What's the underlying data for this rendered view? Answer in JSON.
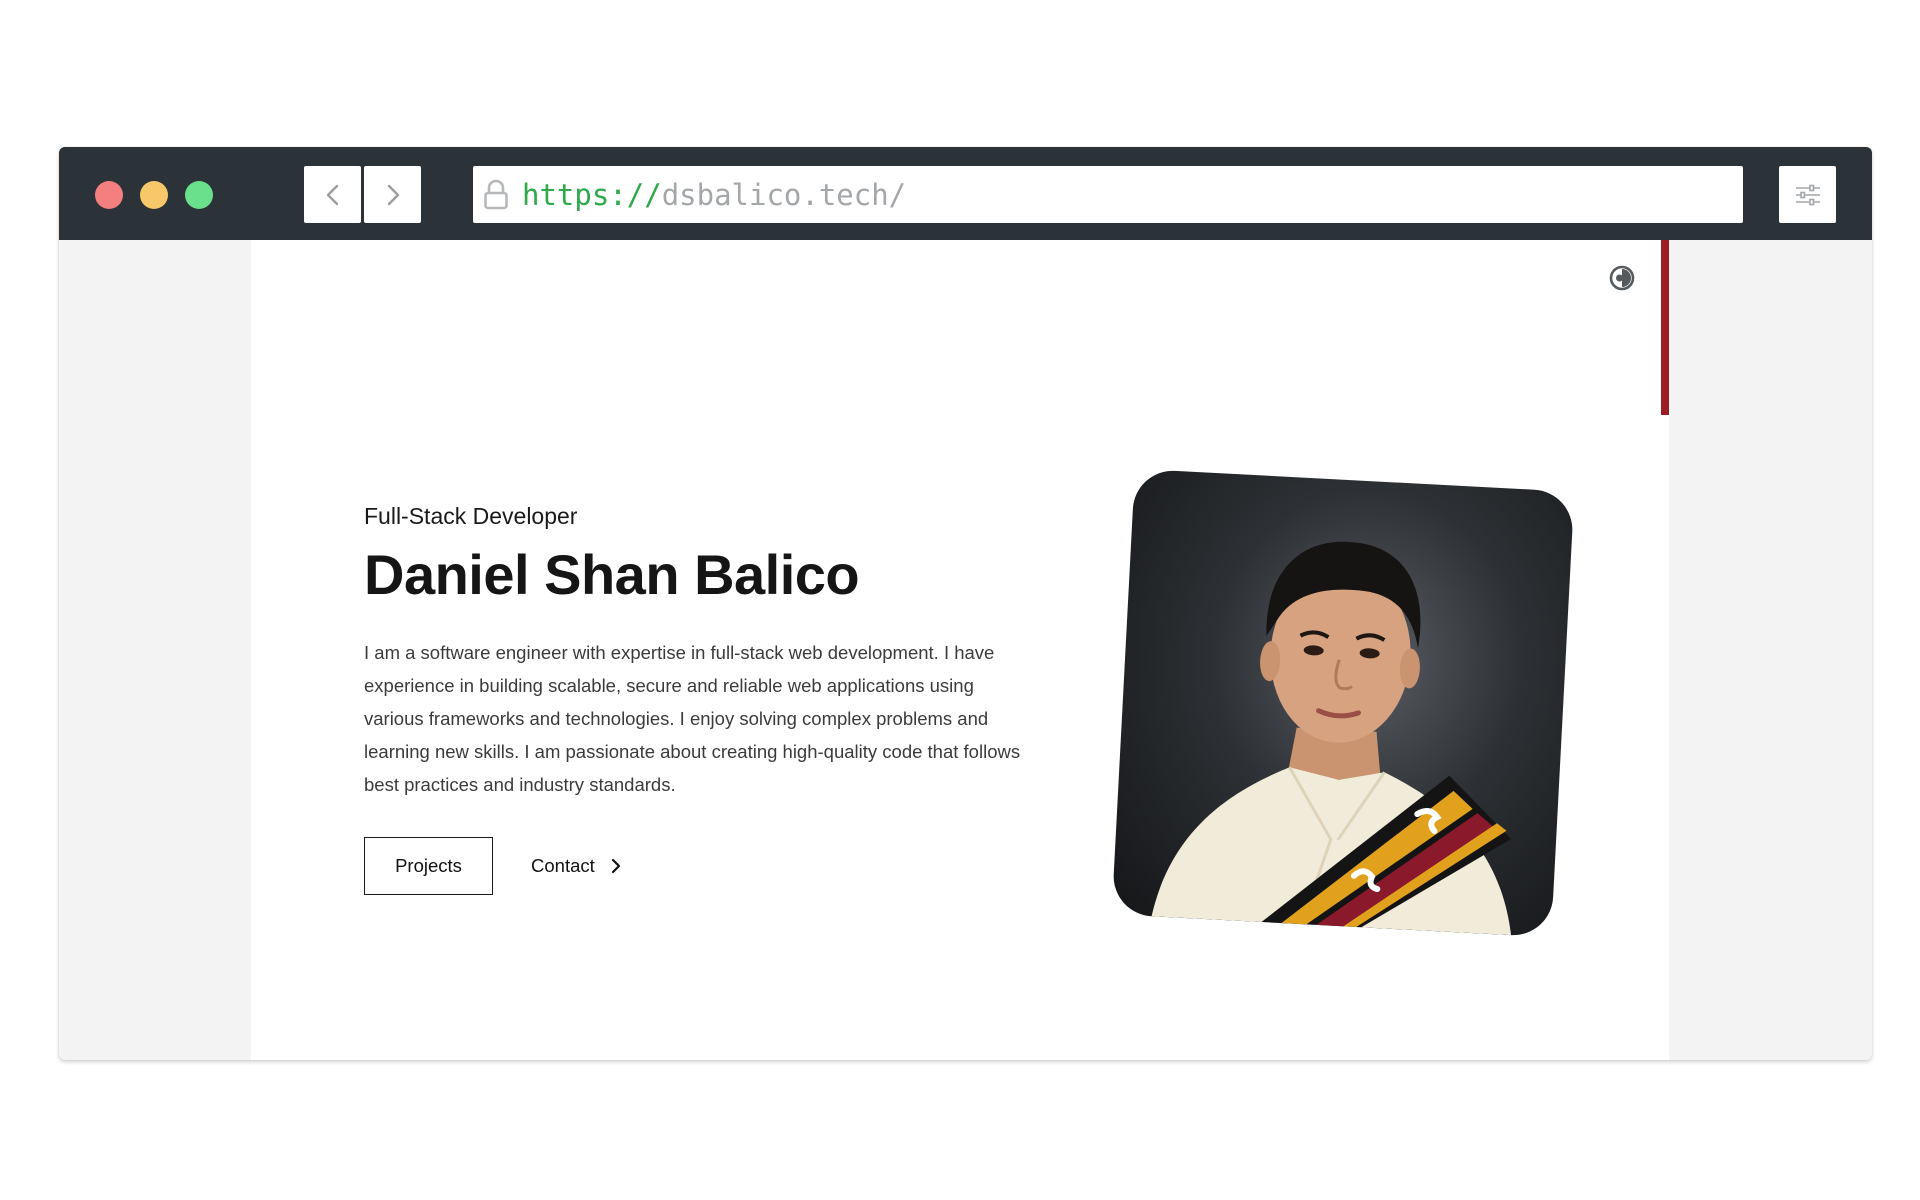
{
  "browser": {
    "url_scheme": "https://",
    "url_host": "dsbalico.tech/",
    "lock_icon": "lock-icon",
    "back_icon": "chevron-left-icon",
    "forward_icon": "chevron-right-icon",
    "menu_icon": "sliders-icon",
    "traffic_lights": {
      "close": "#f47f7f",
      "minimize": "#f6c869",
      "maximize": "#6ae08c"
    }
  },
  "page": {
    "theme_toggle_icon": "contrast-icon",
    "scroll_accent": "#9b1c22",
    "hero": {
      "role": "Full-Stack Developer",
      "name": "Daniel Shan Balico",
      "bio": "I am a software engineer with expertise in full-stack web development. I have experience in building scalable, secure and reliable web applications using various frameworks and technologies. I enjoy solving complex problems and learning new skills. I am passionate about creating high-quality code that follows best practices and industry standards.",
      "projects_label": "Projects",
      "contact_label": "Contact",
      "photo_icon": "portrait-photo"
    }
  }
}
